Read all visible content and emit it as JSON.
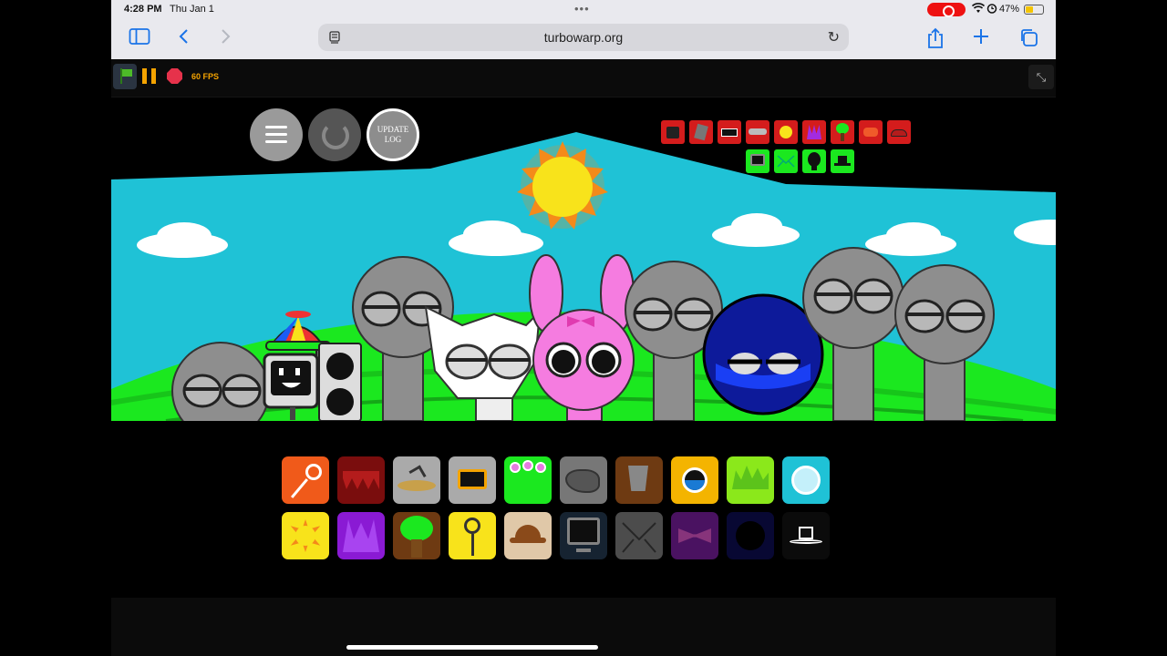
{
  "status_bar": {
    "time": "4:28 PM",
    "date": "Thu Jan 1",
    "battery_percent": "47%",
    "battery_level": 0.47,
    "recording": true
  },
  "browser": {
    "url": "turbowarp.org",
    "icons": [
      "sidebar-icon",
      "back-icon",
      "forward-icon",
      "reload-icon",
      "share-icon",
      "new-tab-icon",
      "tabs-icon"
    ]
  },
  "turbowarp": {
    "fps": "60 FPS"
  },
  "stage": {
    "top_buttons": {
      "update_label": "UPDATE LOG"
    },
    "colors": {
      "sky": "#1fc2d6",
      "grass": "#1be81f",
      "sun": "#f8e31b",
      "sun_rays": "#f48a1a",
      "character_gray": "#8e8e8e",
      "pink_character": "#f57ce0",
      "blue_character": "#0d1a9a"
    },
    "selected_items_row1": [
      "speaker-mouth",
      "gray-tablet",
      "black-screen",
      "teeth-visor",
      "sun-face",
      "purple-spikes",
      "tree",
      "red-crab",
      "red-cap"
    ],
    "selected_items_row2": [
      "monitor",
      "envelope",
      "balloon",
      "top-hat"
    ],
    "palette_row1": [
      "orange-lollipop",
      "red-teeth",
      "straw-hat",
      "robot-visor",
      "flower-crown",
      "gray-beard",
      "brown-bucket",
      "yellow-eye",
      "green-spiky-hair",
      "blue-disc"
    ],
    "palette_row2": [
      "yellow-sun",
      "purple-spikes",
      "green-tree",
      "yellow-lollipop",
      "brown-hat",
      "monitor",
      "envelope",
      "pink-bow",
      "dark-blob",
      "top-hat"
    ]
  }
}
